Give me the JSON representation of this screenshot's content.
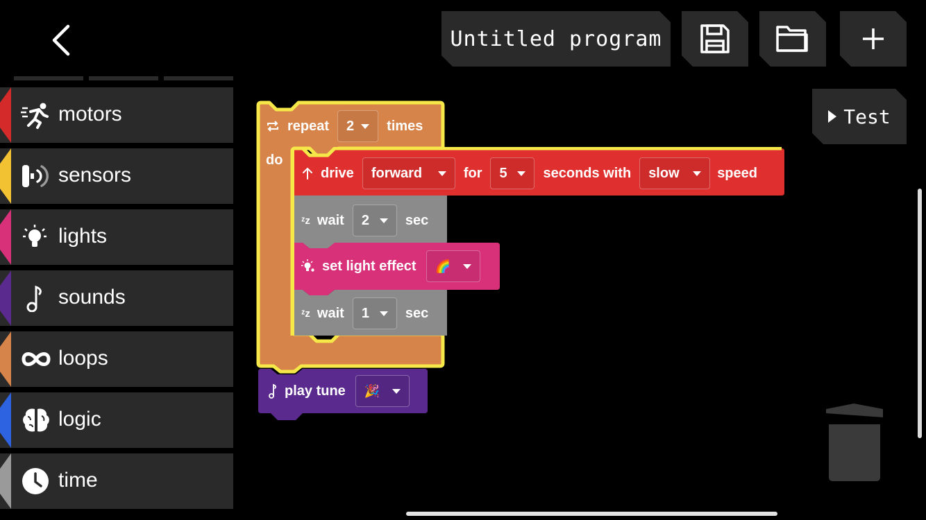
{
  "toolbar": {
    "program_title": "Untitled program",
    "test_label": "Test"
  },
  "categories": [
    {
      "label": "motors",
      "color": "#d42a2a",
      "icon": "running-person-icon"
    },
    {
      "label": "sensors",
      "color": "#f2c233",
      "icon": "sensor-icon"
    },
    {
      "label": "lights",
      "color": "#d8317a",
      "icon": "lightbulb-icon"
    },
    {
      "label": "sounds",
      "color": "#5b2a8e",
      "icon": "music-note-icon"
    },
    {
      "label": "loops",
      "color": "#d7844a",
      "icon": "infinity-icon"
    },
    {
      "label": "logic",
      "color": "#2d62e0",
      "icon": "brain-icon"
    },
    {
      "label": "time",
      "color": "#9a9a9a",
      "icon": "clock-icon"
    }
  ],
  "program": {
    "repeat": {
      "label": "repeat",
      "count": "2",
      "suffix": "times",
      "do_label": "do",
      "color": "#d7844a",
      "highlight": "#f7e84a"
    },
    "drive": {
      "label": "drive",
      "direction": "forward",
      "for_label": "for",
      "duration": "5",
      "seconds_label": "seconds with",
      "speed": "slow",
      "speed_label": "speed",
      "color": "#e02f2f"
    },
    "wait1": {
      "label": "wait",
      "value": "2",
      "unit": "sec",
      "color": "#8b8b8b"
    },
    "light": {
      "label": "set light effect",
      "effect": "🌈",
      "color": "#d8317a"
    },
    "wait2": {
      "label": "wait",
      "value": "1",
      "unit": "sec",
      "color": "#8b8b8b"
    },
    "tune": {
      "label": "play tune",
      "tune": "🎉",
      "color": "#5b2a8e"
    }
  }
}
